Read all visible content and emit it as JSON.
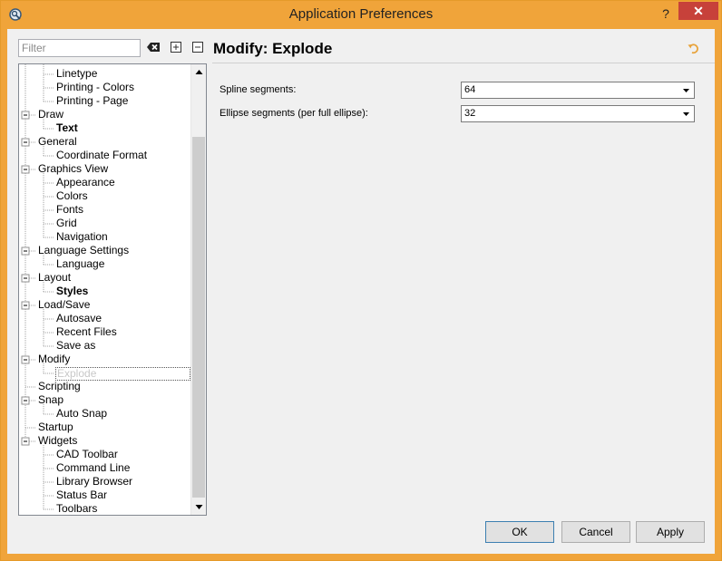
{
  "window": {
    "title": "Application Preferences",
    "help_label": "?",
    "close_label": "✕"
  },
  "colors": {
    "title_bar": "#f0a43a",
    "close_button": "#c7413a",
    "reset_icon": "#e8a33a"
  },
  "sidebar": {
    "filter_placeholder": "Filter",
    "tree": [
      {
        "label": "Linetype",
        "level": 1,
        "bold": false
      },
      {
        "label": "Printing - Colors",
        "level": 1,
        "bold": false
      },
      {
        "label": "Printing - Page",
        "level": 1,
        "bold": false
      },
      {
        "label": "Draw",
        "level": 0,
        "expanded": true
      },
      {
        "label": "Text",
        "level": 1,
        "bold": true
      },
      {
        "label": "General",
        "level": 0,
        "expanded": true
      },
      {
        "label": "Coordinate Format",
        "level": 1,
        "bold": false
      },
      {
        "label": "Graphics View",
        "level": 0,
        "expanded": true
      },
      {
        "label": "Appearance",
        "level": 1,
        "bold": false
      },
      {
        "label": "Colors",
        "level": 1,
        "bold": false
      },
      {
        "label": "Fonts",
        "level": 1,
        "bold": false
      },
      {
        "label": "Grid",
        "level": 1,
        "bold": false
      },
      {
        "label": "Navigation",
        "level": 1,
        "bold": false
      },
      {
        "label": "Language Settings",
        "level": 0,
        "expanded": true
      },
      {
        "label": "Language",
        "level": 1,
        "bold": false
      },
      {
        "label": "Layout",
        "level": 0,
        "expanded": true
      },
      {
        "label": "Styles",
        "level": 1,
        "bold": true
      },
      {
        "label": "Load/Save",
        "level": 0,
        "expanded": true
      },
      {
        "label": "Autosave",
        "level": 1,
        "bold": false
      },
      {
        "label": "Recent Files",
        "level": 1,
        "bold": false
      },
      {
        "label": "Save as",
        "level": 1,
        "bold": false
      },
      {
        "label": "Modify",
        "level": 0,
        "expanded": true
      },
      {
        "label": "Explode",
        "level": 1,
        "bold": false,
        "selected": true
      },
      {
        "label": "Scripting",
        "level": 0
      },
      {
        "label": "Snap",
        "level": 0,
        "expanded": true
      },
      {
        "label": "Auto Snap",
        "level": 1,
        "bold": false
      },
      {
        "label": "Startup",
        "level": 0
      },
      {
        "label": "Widgets",
        "level": 0,
        "expanded": true
      },
      {
        "label": "CAD Toolbar",
        "level": 1,
        "bold": false
      },
      {
        "label": "Command Line",
        "level": 1,
        "bold": false
      },
      {
        "label": "Library Browser",
        "level": 1,
        "bold": false
      },
      {
        "label": "Status Bar",
        "level": 1,
        "bold": false
      },
      {
        "label": "Toolbars",
        "level": 1,
        "bold": false
      }
    ]
  },
  "page": {
    "title": "Modify: Explode",
    "fields": [
      {
        "label": "Spline segments:",
        "value": "64"
      },
      {
        "label": "Ellipse segments (per full ellipse):",
        "value": "32"
      }
    ]
  },
  "buttons": {
    "ok": "OK",
    "cancel": "Cancel",
    "apply": "Apply"
  }
}
